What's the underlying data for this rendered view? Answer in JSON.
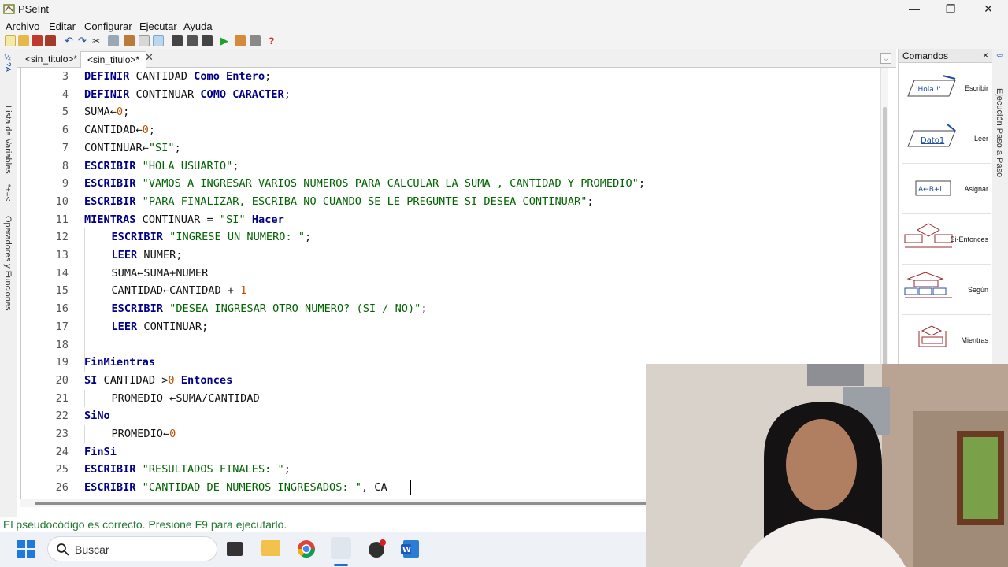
{
  "window": {
    "title": "PSeInt",
    "controls": [
      "minimize",
      "restore",
      "close"
    ]
  },
  "menu": [
    "Archivo",
    "Editar",
    "Configurar",
    "Ejecutar",
    "Ayuda"
  ],
  "left_panel": {
    "sections": [
      "Lista de Variables",
      "Operadores y Funciones"
    ]
  },
  "tabs": [
    {
      "label": "<sin_titulo>*",
      "active": false
    },
    {
      "label": "<sin_titulo>*",
      "active": true
    }
  ],
  "tab_close": "✕",
  "tab_dropdown": "⌵",
  "editor": {
    "lines": [
      {
        "n": "3",
        "indent": 0,
        "tokens": [
          [
            "kw",
            "DEFINIR"
          ],
          [
            "t",
            " CANTIDAD "
          ],
          [
            "kw",
            "Como Entero"
          ],
          [
            "t",
            ";"
          ]
        ]
      },
      {
        "n": "4",
        "indent": 0,
        "tokens": [
          [
            "kw",
            "DEFINIR"
          ],
          [
            "t",
            " CONTINUAR "
          ],
          [
            "kw",
            "COMO CARACTER"
          ],
          [
            "t",
            ";"
          ]
        ]
      },
      {
        "n": "5",
        "indent": 0,
        "tokens": [
          [
            "t",
            "SUMA←"
          ],
          [
            "num",
            "0"
          ],
          [
            "t",
            ";"
          ]
        ]
      },
      {
        "n": "6",
        "indent": 0,
        "tokens": [
          [
            "t",
            "CANTIDAD←"
          ],
          [
            "num",
            "0"
          ],
          [
            "t",
            ";"
          ]
        ]
      },
      {
        "n": "7",
        "indent": 0,
        "tokens": [
          [
            "t",
            "CONTINUAR←"
          ],
          [
            "str",
            "\"SI\""
          ],
          [
            "t",
            ";"
          ]
        ]
      },
      {
        "n": "8",
        "indent": 0,
        "tokens": [
          [
            "kw",
            "ESCRIBIR"
          ],
          [
            "t",
            " "
          ],
          [
            "str",
            "\"HOLA USUARIO\""
          ],
          [
            "t",
            ";"
          ]
        ]
      },
      {
        "n": "9",
        "indent": 0,
        "tokens": [
          [
            "kw",
            "ESCRIBIR"
          ],
          [
            "t",
            " "
          ],
          [
            "str",
            "\"VAMOS A INGRESAR VARIOS NUMEROS PARA CALCULAR LA SUMA , CANTIDAD Y PROMEDIO\""
          ],
          [
            "t",
            ";"
          ]
        ]
      },
      {
        "n": "10",
        "indent": 0,
        "tokens": [
          [
            "kw",
            "ESCRIBIR"
          ],
          [
            "t",
            " "
          ],
          [
            "str",
            "\"PARA FINALIZAR, ESCRIBA NO CUANDO SE LE PREGUNTE SI DESEA CONTINUAR\""
          ],
          [
            "t",
            ";"
          ]
        ]
      },
      {
        "n": "11",
        "indent": 0,
        "tokens": [
          [
            "kw",
            "MIENTRAS"
          ],
          [
            "t",
            " CONTINUAR = "
          ],
          [
            "str",
            "\"SI\""
          ],
          [
            "t",
            " "
          ],
          [
            "kw",
            "Hacer"
          ]
        ]
      },
      {
        "n": "12",
        "indent": 1,
        "tokens": [
          [
            "kw",
            "ESCRIBIR"
          ],
          [
            "t",
            " "
          ],
          [
            "str",
            "\"INGRESE UN NUMERO: \""
          ],
          [
            "t",
            ";"
          ]
        ]
      },
      {
        "n": "13",
        "indent": 1,
        "tokens": [
          [
            "kw",
            "LEER"
          ],
          [
            "t",
            " NUMER;"
          ]
        ]
      },
      {
        "n": "14",
        "indent": 1,
        "tokens": [
          [
            "t",
            "SUMA←SUMA+NUMER"
          ]
        ]
      },
      {
        "n": "15",
        "indent": 1,
        "tokens": [
          [
            "t",
            "CANTIDAD←CANTIDAD + "
          ],
          [
            "num",
            "1"
          ]
        ]
      },
      {
        "n": "16",
        "indent": 1,
        "tokens": [
          [
            "kw",
            "ESCRIBIR"
          ],
          [
            "t",
            " "
          ],
          [
            "str",
            "\"DESEA INGRESAR OTRO NUMERO? (SI / NO)\""
          ],
          [
            "t",
            ";"
          ]
        ]
      },
      {
        "n": "17",
        "indent": 1,
        "tokens": [
          [
            "kw",
            "LEER"
          ],
          [
            "t",
            " CONTINUAR;"
          ]
        ]
      },
      {
        "n": "18",
        "indent": 1,
        "tokens": []
      },
      {
        "n": "19",
        "indent": 0,
        "tokens": [
          [
            "kw",
            "FinMientras"
          ]
        ]
      },
      {
        "n": "20",
        "indent": 0,
        "tokens": [
          [
            "kw",
            "SI"
          ],
          [
            "t",
            " CANTIDAD >"
          ],
          [
            "num",
            "0"
          ],
          [
            "t",
            " "
          ],
          [
            "kw",
            "Entonces"
          ]
        ]
      },
      {
        "n": "21",
        "indent": 1,
        "tokens": [
          [
            "t",
            "PROMEDIO ←SUMA/CANTIDAD"
          ]
        ]
      },
      {
        "n": "22",
        "indent": 0,
        "tokens": [
          [
            "kw",
            "SiNo"
          ]
        ]
      },
      {
        "n": "23",
        "indent": 1,
        "tokens": [
          [
            "t",
            "PROMEDIO←"
          ],
          [
            "num",
            "0"
          ]
        ]
      },
      {
        "n": "24",
        "indent": 0,
        "tokens": [
          [
            "kw",
            "FinSi"
          ]
        ]
      },
      {
        "n": "25",
        "indent": 0,
        "tokens": [
          [
            "kw",
            "ESCRIBIR"
          ],
          [
            "t",
            " "
          ],
          [
            "str",
            "\"RESULTADOS FINALES: \""
          ],
          [
            "t",
            ";"
          ]
        ]
      },
      {
        "n": "26",
        "indent": 0,
        "tokens": [
          [
            "kw",
            "ESCRIBIR"
          ],
          [
            "t",
            " "
          ],
          [
            "str",
            "\"CANTIDAD DE NUMEROS INGRESADOS: \""
          ],
          [
            "t",
            ", CA"
          ]
        ]
      }
    ]
  },
  "status": "El pseudocódigo es correcto. Presione F9 para ejecutarlo.",
  "commands_panel": {
    "title": "Comandos",
    "close": "×",
    "items": [
      {
        "label": "Escribir",
        "icon_text": "'Hola !'",
        "icon": "escribir-icon"
      },
      {
        "label": "Leer",
        "icon_text": "Dato1",
        "icon": "leer-icon"
      },
      {
        "label": "Asignar",
        "icon_text": "A←B+i",
        "icon": "asignar-icon"
      },
      {
        "label": "Si-Entonces",
        "icon": "si-entonces-icon"
      },
      {
        "label": "Según",
        "icon": "segun-icon"
      },
      {
        "label": "Mientras",
        "icon": "mientras-icon"
      }
    ]
  },
  "right_strip": "Ejecución Paso a Paso",
  "taskbar": {
    "search_placeholder": "Buscar",
    "apps": [
      "start",
      "search",
      "file-explorer",
      "folder",
      "chrome",
      "pseint",
      "obs",
      "word"
    ]
  },
  "colors": {
    "keyword": "#00008b",
    "string": "#006400",
    "number": "#c05000",
    "status_ok": "#1f7a2e"
  }
}
